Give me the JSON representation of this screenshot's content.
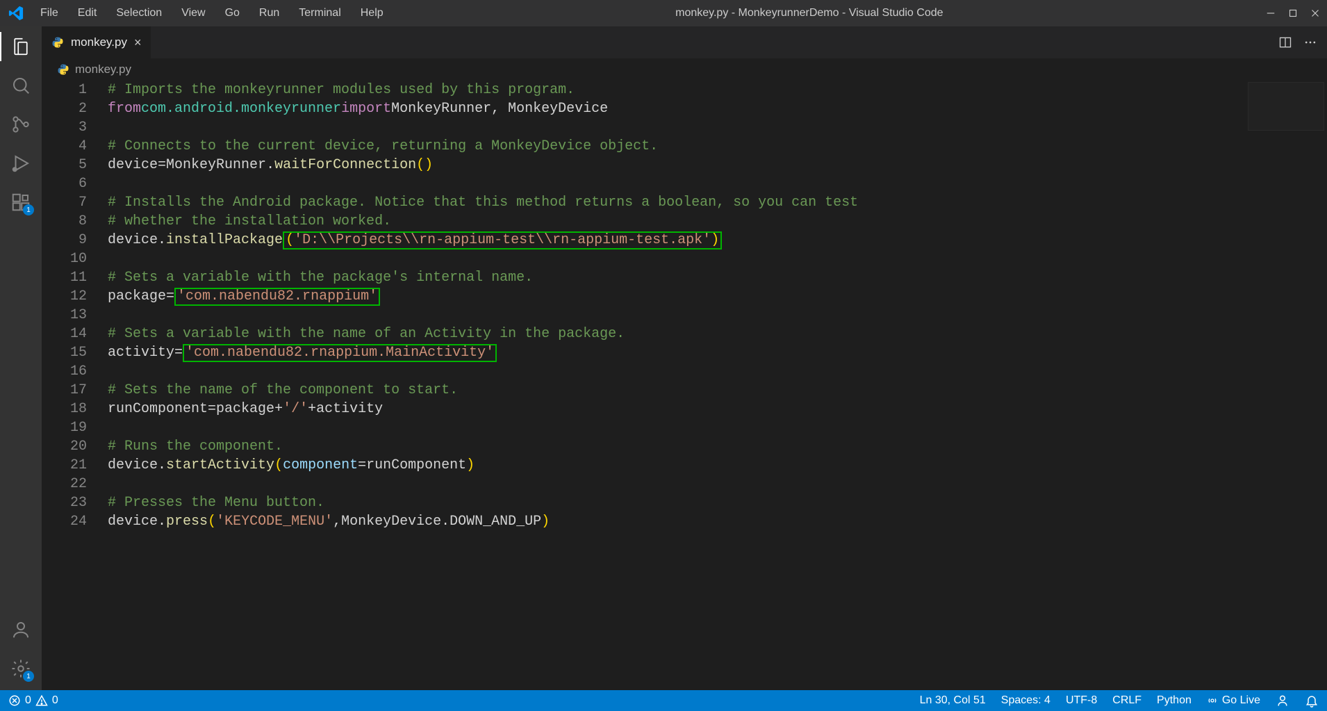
{
  "titlebar": {
    "menus": [
      "File",
      "Edit",
      "Selection",
      "View",
      "Go",
      "Run",
      "Terminal",
      "Help"
    ],
    "title": "monkey.py - MonkeyrunnerDemo - Visual Studio Code"
  },
  "activity": {
    "items": [
      {
        "name": "explorer-icon",
        "active": true,
        "badge": null
      },
      {
        "name": "search-icon",
        "active": false,
        "badge": null
      },
      {
        "name": "source-control-icon",
        "active": false,
        "badge": null
      },
      {
        "name": "run-debug-icon",
        "active": false,
        "badge": null
      },
      {
        "name": "extensions-icon",
        "active": false,
        "badge": "1"
      }
    ],
    "bottom": [
      {
        "name": "accounts-icon",
        "badge": null
      },
      {
        "name": "settings-gear-icon",
        "badge": "1"
      }
    ]
  },
  "tab": {
    "label": "monkey.py"
  },
  "breadcrumb": {
    "label": "monkey.py"
  },
  "code": {
    "lines": [
      {
        "n": 1,
        "t": "comment",
        "text": "# Imports the monkeyrunner modules used by this program."
      },
      {
        "n": 2,
        "t": "import",
        "from": "from",
        "mod": "com.android.monkeyrunner",
        "imp": "import",
        "names": "MonkeyRunner, MonkeyDevice"
      },
      {
        "n": 3,
        "t": "blank"
      },
      {
        "n": 4,
        "t": "comment",
        "text": "# Connects to the current device, returning a MonkeyDevice object."
      },
      {
        "n": 5,
        "t": "assign_call",
        "lhs": "device",
        "obj": "MonkeyRunner",
        "fn": "waitForConnection",
        "args": ""
      },
      {
        "n": 6,
        "t": "blank"
      },
      {
        "n": 7,
        "t": "comment",
        "text": "# Installs the Android package. Notice that this method returns a boolean, so you can test"
      },
      {
        "n": 8,
        "t": "comment",
        "text": "# whether the installation worked."
      },
      {
        "n": 9,
        "t": "call_hl",
        "obj": "device",
        "fn": "installPackage",
        "argstr": "'D:\\\\Projects\\\\rn-appium-test\\\\rn-appium-test.apk'"
      },
      {
        "n": 10,
        "t": "blank"
      },
      {
        "n": 11,
        "t": "comment",
        "text": "# Sets a variable with the package's internal name."
      },
      {
        "n": 12,
        "t": "assign_str_hl",
        "lhs": "package",
        "str": "'com.nabendu82.rnappium'"
      },
      {
        "n": 13,
        "t": "blank"
      },
      {
        "n": 14,
        "t": "comment",
        "text": "# Sets a variable with the name of an Activity in the package."
      },
      {
        "n": 15,
        "t": "assign_str_hl",
        "lhs": "activity",
        "str": "'com.nabendu82.rnappium.MainActivity'"
      },
      {
        "n": 16,
        "t": "blank"
      },
      {
        "n": 17,
        "t": "comment",
        "text": "# Sets the name of the component to start."
      },
      {
        "n": 18,
        "t": "concat",
        "lhs": "runComponent",
        "a": "package",
        "mid": "'/'",
        "b": "activity"
      },
      {
        "n": 19,
        "t": "blank"
      },
      {
        "n": 20,
        "t": "comment",
        "text": "# Runs the component."
      },
      {
        "n": 21,
        "t": "kw_call",
        "obj": "device",
        "fn": "startActivity",
        "kw": "component",
        "val": "runComponent"
      },
      {
        "n": 22,
        "t": "blank"
      },
      {
        "n": 23,
        "t": "comment",
        "text": "# Presses the Menu button."
      },
      {
        "n": 24,
        "t": "press",
        "obj": "device",
        "fn": "press",
        "s": "'KEYCODE_MENU'",
        "enum": "MonkeyDevice.DOWN_AND_UP"
      }
    ]
  },
  "status": {
    "errors": "0",
    "warnings": "0",
    "lncol": "Ln 30, Col 51",
    "spaces": "Spaces: 4",
    "encoding": "UTF-8",
    "eol": "CRLF",
    "lang": "Python",
    "golive": "Go Live"
  }
}
